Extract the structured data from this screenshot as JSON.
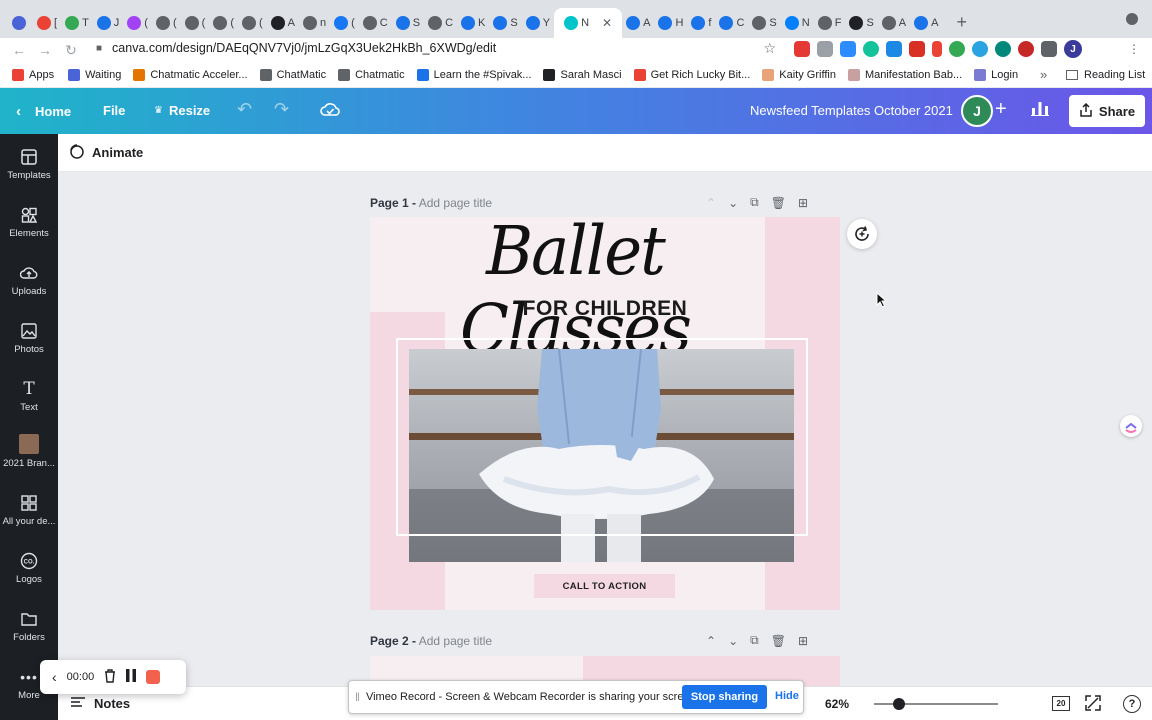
{
  "browser": {
    "tabs": [
      {
        "label": "",
        "color": "#4a63d6"
      },
      {
        "label": "[",
        "color": "#ea4335"
      },
      {
        "label": "T",
        "color": "#34a853"
      },
      {
        "label": "J",
        "color": "#1a73e8"
      },
      {
        "label": "(",
        "color": "#a142f4"
      },
      {
        "label": "(",
        "color": "#5f6368"
      },
      {
        "label": "(",
        "color": "#5f6368"
      },
      {
        "label": "(",
        "color": "#5f6368"
      },
      {
        "label": "(",
        "color": "#5f6368"
      },
      {
        "label": "A",
        "color": "#202124"
      },
      {
        "label": "n",
        "color": "#5f6368"
      },
      {
        "label": "(",
        "color": "#1877f2"
      },
      {
        "label": "C",
        "color": "#5f6368"
      },
      {
        "label": "S",
        "color": "#1a73e8"
      },
      {
        "label": "C",
        "color": "#5f6368"
      },
      {
        "label": "K",
        "color": "#1a73e8"
      },
      {
        "label": "S",
        "color": "#1a73e8"
      },
      {
        "label": "Y",
        "color": "#1a73e8"
      }
    ],
    "active_tab": {
      "label": "N",
      "color": "#00c4cc"
    },
    "tabs_after": [
      {
        "label": "A",
        "color": "#1a73e8"
      },
      {
        "label": "H",
        "color": "#1a73e8"
      },
      {
        "label": "f",
        "color": "#1a73e8"
      },
      {
        "label": "C",
        "color": "#1a73e8"
      },
      {
        "label": "S",
        "color": "#5f6368"
      },
      {
        "label": "N",
        "color": "#0081fb"
      },
      {
        "label": "F",
        "color": "#5f6368"
      },
      {
        "label": "S",
        "color": "#202124"
      },
      {
        "label": "A",
        "color": "#5f6368"
      },
      {
        "label": "A",
        "color": "#1a73e8"
      }
    ],
    "new_tab": "+",
    "url": "canva.com/design/DAEqQNV7Vj0/jmLzGqX3Uek2HkBh_6XWDg/edit",
    "bookmarks": [
      {
        "label": "Apps",
        "color": "#ea4335"
      },
      {
        "label": "Waiting",
        "color": "#4a63d6"
      },
      {
        "label": "Chatmatic Acceler...",
        "color": "#e37400"
      },
      {
        "label": "ChatMatic",
        "color": "#5f6368"
      },
      {
        "label": "Chatmatic",
        "color": "#5f6368"
      },
      {
        "label": "Learn the #Spivak...",
        "color": "#1a73e8"
      },
      {
        "label": "Sarah Masci",
        "color": "#202124"
      },
      {
        "label": "Get Rich Lucky Bit...",
        "color": "#ea4335"
      },
      {
        "label": "Kaity Griffin",
        "color": "#e8a37a"
      },
      {
        "label": "Manifestation Bab...",
        "color": "#c9a0a0"
      },
      {
        "label": "Login",
        "color": "#7b7bd1"
      }
    ],
    "bookmarks_more": "»",
    "reading_list": "Reading List",
    "profile_initial": "J"
  },
  "canva": {
    "header": {
      "home": "Home",
      "file": "File",
      "resize": "Resize",
      "doc_title": "Newsfeed Templates October 2021",
      "avatar_initial": "J",
      "share": "Share"
    },
    "toolbar": {
      "animate": "Animate"
    },
    "sidebar": [
      {
        "label": "Templates",
        "icon": "templates-icon"
      },
      {
        "label": "Elements",
        "icon": "elements-icon"
      },
      {
        "label": "Uploads",
        "icon": "uploads-icon"
      },
      {
        "label": "Photos",
        "icon": "photos-icon"
      },
      {
        "label": "Text",
        "icon": "text-icon"
      },
      {
        "label": "2021 Bran...",
        "icon": "brand-thumbnail"
      },
      {
        "label": "All your de...",
        "icon": "all-designs-icon"
      },
      {
        "label": "Logos",
        "icon": "logos-icon"
      },
      {
        "label": "Folders",
        "icon": "folders-icon"
      },
      {
        "label": "More",
        "icon": "more-icon"
      }
    ],
    "page1": {
      "label": "Page 1 -",
      "title_placeholder": "Add page title",
      "script_title": "Ballet Classes",
      "subtitle": "FOR CHILDREN",
      "cta": "CALL TO ACTION"
    },
    "page2": {
      "label": "Page 2 -",
      "title_placeholder": "Add page title"
    },
    "bottom": {
      "notes": "Notes",
      "zoom": "62%",
      "zoom_level": 0.2,
      "page_count": "20"
    }
  },
  "recorder": {
    "time": "00:00"
  },
  "share_notice": {
    "message": "Vimeo Record - Screen & Webcam Recorder is sharing your screen.",
    "stop": "Stop sharing",
    "hide": "Hide"
  },
  "colors": {
    "header_gradient_start": "#1fb4c9",
    "header_gradient_end": "#6b56e8",
    "sidebar_bg": "#1c2025",
    "canvas_bg": "#ebecf0",
    "pink": "#f4d9e3",
    "stop_sharing": "#1a73e8"
  }
}
